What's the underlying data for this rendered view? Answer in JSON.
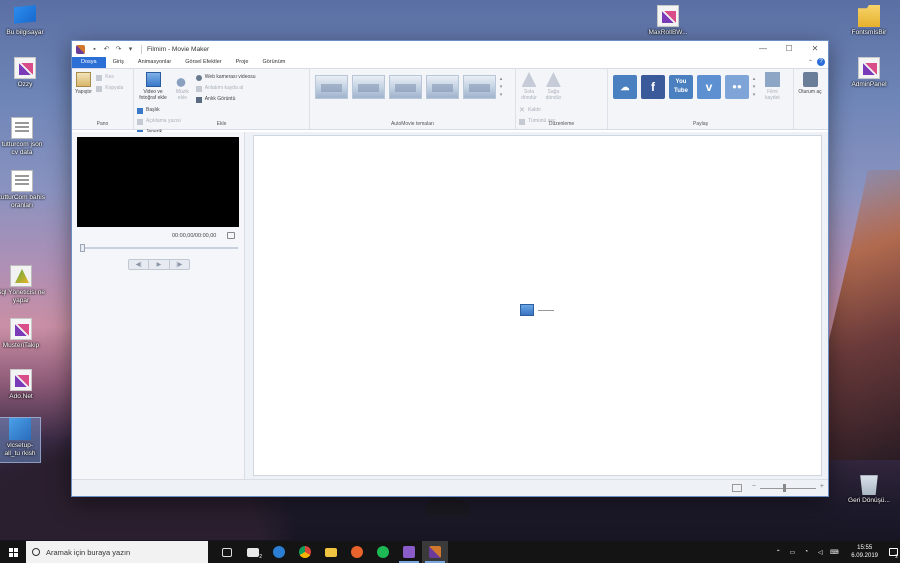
{
  "desktop": {
    "icons": [
      {
        "label": "Bu bilgisayar"
      },
      {
        "label": "Ozzy"
      },
      {
        "label": "tutturcom json cv data"
      },
      {
        "label": "tutturCom bahis oranları"
      },
      {
        "label": "Sql Yöneticisi ne yapar"
      },
      {
        "label": "MusteriTakip"
      },
      {
        "label": "Ado.Net"
      },
      {
        "label": "vlcsetup-all_tu rkish"
      },
      {
        "label": "MaxRollBW..."
      },
      {
        "label": "FontsmIsBir"
      },
      {
        "label": "AdminPanel"
      },
      {
        "label": "Geri Dönüşü..."
      }
    ]
  },
  "window": {
    "title": "Filmim - Movie Maker",
    "qa_undo": "↶",
    "qa_redo": "↷",
    "qa_more": "▾",
    "minimize": "—",
    "maximize": "☐",
    "close": "✕",
    "tabs": [
      "Dosya",
      "Giriş",
      "Animasyonlar",
      "Görsel Efektler",
      "Proje",
      "Görünüm"
    ],
    "collapse": "⌃",
    "help": "?"
  },
  "ribbon": {
    "pano": {
      "label": "Pano",
      "paste": "Yapıştır",
      "cut": "Kes",
      "copy": "Kopyala"
    },
    "ekle": {
      "label": "Ekle",
      "add_video": "Video ve fotoğraf ekle",
      "music": "Müzik ekle",
      "webcam": "Web kamerası videosu",
      "narration": "Anlatımı kayda al",
      "snapshot": "Anlık Görüntü",
      "title": "Başlık",
      "caption": "Açıklama yazısı",
      "credits": "Jenerik"
    },
    "automovie": {
      "label": "AutoMovie temaları"
    },
    "duzenleme": {
      "label": "Düzenleme",
      "rotate_left": "Sola döndür",
      "rotate_right": "Sağa döndür",
      "remove": "Kaldır",
      "select_all": "Tümünü seç"
    },
    "paylas": {
      "label": "Paylaş",
      "youtube": "You Tube",
      "facebook": "f",
      "vimeo": "v",
      "flickr": "●●",
      "save_movie": "Filmi kaydet",
      "sign_in": "Oturum aç"
    }
  },
  "preview": {
    "timecode": "00:00,00/00:00,00",
    "prev": "◀|",
    "play": "▶",
    "next": "|▶"
  },
  "statusbar": {
    "zoom_minus": "−",
    "zoom_plus": "+"
  },
  "taskbar": {
    "search_placeholder": "Aramak için buraya yazın",
    "mail_badge": "2",
    "time": "15:55",
    "date": "6.09.2019",
    "notif_count": "2"
  },
  "colors": {
    "accent": "#2b6ed6",
    "taskbar": "#141414"
  }
}
